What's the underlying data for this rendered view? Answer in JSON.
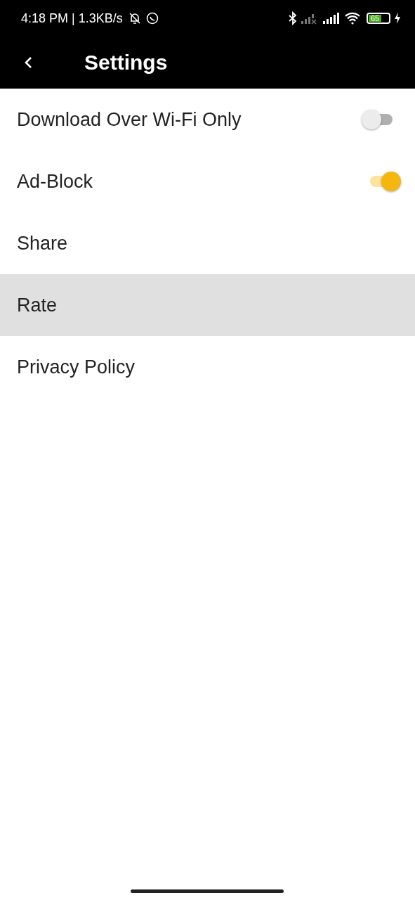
{
  "status_bar": {
    "time": "4:18 PM",
    "speed": "| 1.3KB/s",
    "battery": "65"
  },
  "app_bar": {
    "title": "Settings"
  },
  "items": [
    {
      "kind": "toggle",
      "label": "Download Over Wi-Fi Only",
      "on": false,
      "selected": false
    },
    {
      "kind": "toggle",
      "label": "Ad-Block",
      "on": true,
      "selected": false
    },
    {
      "kind": "plain",
      "label": "Share",
      "selected": false
    },
    {
      "kind": "plain",
      "label": "Rate",
      "selected": true
    },
    {
      "kind": "plain",
      "label": "Privacy Policy",
      "selected": false
    }
  ]
}
